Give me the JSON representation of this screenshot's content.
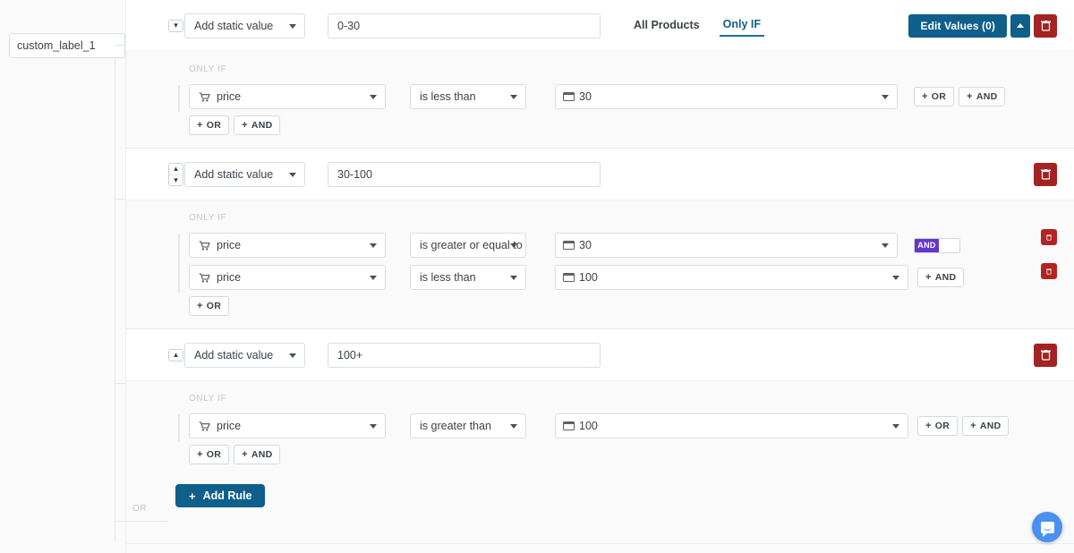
{
  "label_field": {
    "value": "custom_label_1",
    "name": "custom-label-input"
  },
  "tabs": [
    {
      "label": "All Products",
      "active": false
    },
    {
      "label": "Only IF",
      "active": true
    }
  ],
  "header_actions": {
    "edit_values_label": "Edit Values (0)",
    "collapse_label": "",
    "delete_label": ""
  },
  "colors": {
    "primary_blue": "#0e5f8a",
    "danger_red": "#a32222",
    "danger_red_small": "#b42323",
    "toggle_purple": "#6536cc",
    "chat_blue": "#4a90f0",
    "page_bg": "#fafafa",
    "card_bg": "#ffffff",
    "border": "#d9dee3",
    "muted_text": "#c3c7cc"
  },
  "only_if_label": "ONLY IF",
  "or_connector_label": "OR",
  "mini_buttons": {
    "or": "+ OR",
    "and": "+ AND",
    "or_text": "OR",
    "and_text": "AND",
    "plus": "+"
  },
  "add_rule": {
    "label": "Add Rule",
    "plus": "+"
  },
  "rules": [
    {
      "value_source": "Add static value",
      "static_value": "0-30",
      "conditions": [
        {
          "field": "price",
          "operator": "is less than",
          "value": "30",
          "field_icon": "cart-icon",
          "value_icon": "card-icon"
        }
      ],
      "row_buttons": [
        "+ OR",
        "+ AND"
      ],
      "footer_buttons": [
        "+ OR",
        "+ AND"
      ]
    },
    {
      "value_source": "Add static value",
      "static_value": "30-100",
      "conditions": [
        {
          "field": "price",
          "operator": "is greater or equal to",
          "value": "30",
          "field_icon": "cart-icon",
          "value_icon": "card-icon",
          "toggle": "AND"
        },
        {
          "field": "price",
          "operator": "is less than",
          "value": "100",
          "field_icon": "cart-icon",
          "value_icon": "card-icon",
          "and_button": "+ AND"
        }
      ],
      "footer_buttons": [
        "+ OR"
      ]
    },
    {
      "value_source": "Add static value",
      "static_value": "100+",
      "conditions": [
        {
          "field": "price",
          "operator": "is greater than",
          "value": "100",
          "field_icon": "cart-icon",
          "value_icon": "card-icon"
        }
      ],
      "row_buttons": [
        "+ OR",
        "+ AND"
      ],
      "footer_buttons": [
        "+ OR",
        "+ AND"
      ]
    }
  ]
}
